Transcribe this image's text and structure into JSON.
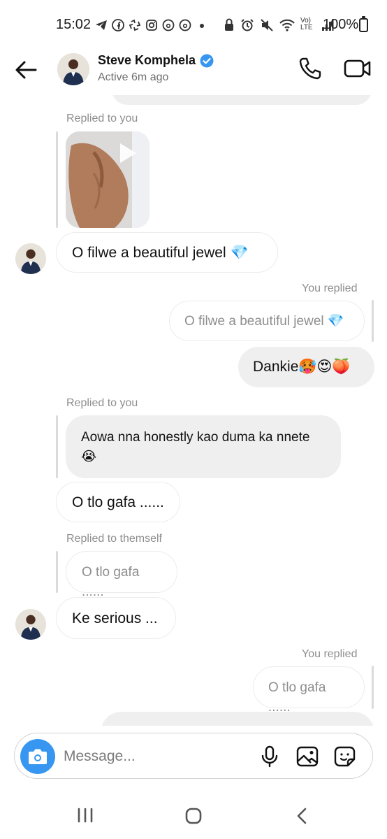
{
  "status_bar": {
    "time": "15:02",
    "battery": "100%",
    "icons": [
      "telegram-icon",
      "facebook-icon",
      "messenger-icon",
      "instagram-icon",
      "threads-icon",
      "threads-icon",
      "dot-icon",
      "lock-icon",
      "alarm-icon",
      "mute-icon",
      "wifi-icon",
      "volte-icon",
      "signal-icon",
      "battery-icon"
    ],
    "network_label": "Vo) LTE"
  },
  "header": {
    "contact_name": "Steve Komphela",
    "active_status": "Active 6m ago",
    "verified": true,
    "accent": "#3797f0"
  },
  "messages": [
    {
      "reply_label": "Replied to you",
      "quoted_media": "video-thumbnail",
      "text": "O filwe a beautiful jewel 💎",
      "sender": "them"
    },
    {
      "reply_label": "You replied",
      "quoted_text": "O filwe a beautiful jewel 💎",
      "text": "Dankie🥵😍🍑",
      "sender": "me"
    },
    {
      "reply_label": "Replied to you",
      "quoted_text": "Aowa nna honestly kao duma ka nnete 😭",
      "text": "O tlo gafa ......",
      "sender": "them"
    },
    {
      "reply_label": "Replied to themself",
      "quoted_text": "O tlo gafa ......",
      "text": "Ke serious ...",
      "sender": "them"
    },
    {
      "reply_label": "You replied",
      "quoted_text": "O tlo gafa ......",
      "sender": "me"
    }
  ],
  "composer": {
    "placeholder": "Message...",
    "icons": [
      "camera-icon",
      "microphone-icon",
      "gallery-icon",
      "sticker-icon"
    ]
  },
  "nav": {
    "icons": [
      "recents-icon",
      "home-icon",
      "back-icon"
    ]
  }
}
